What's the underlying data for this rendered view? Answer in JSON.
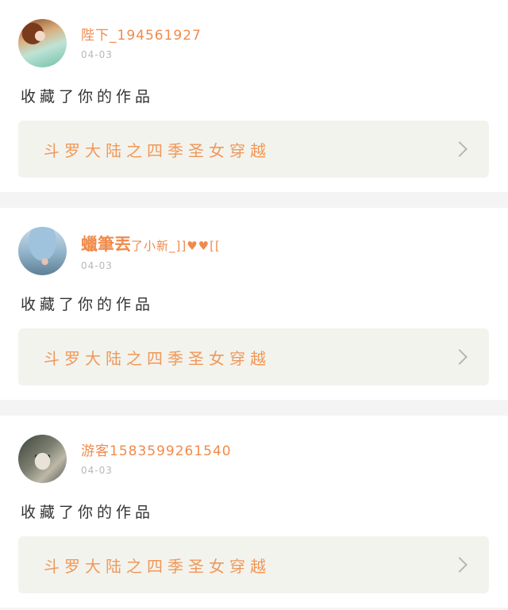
{
  "posts": [
    {
      "username": "陛下_194561927",
      "date": "04-03",
      "action": "收藏了你的作品",
      "work_title": "斗罗大陆之四季圣女穿越",
      "avatar": "avatar-anime-girl"
    },
    {
      "username_main": "蠟筆丟",
      "username_rest": "了小新_]]♥♥[[",
      "date": "04-03",
      "action": "收藏了你的作品",
      "work_title": "斗罗大陆之四季圣女穿越",
      "avatar": "avatar-umbrella-scene"
    },
    {
      "username": "游客1583599261540",
      "date": "04-03",
      "action": "收藏了你的作品",
      "work_title": "斗罗大陆之四季圣女穿越",
      "avatar": "avatar-white-tiger"
    }
  ],
  "icons": {
    "chevron": "chevron-right-icon"
  }
}
